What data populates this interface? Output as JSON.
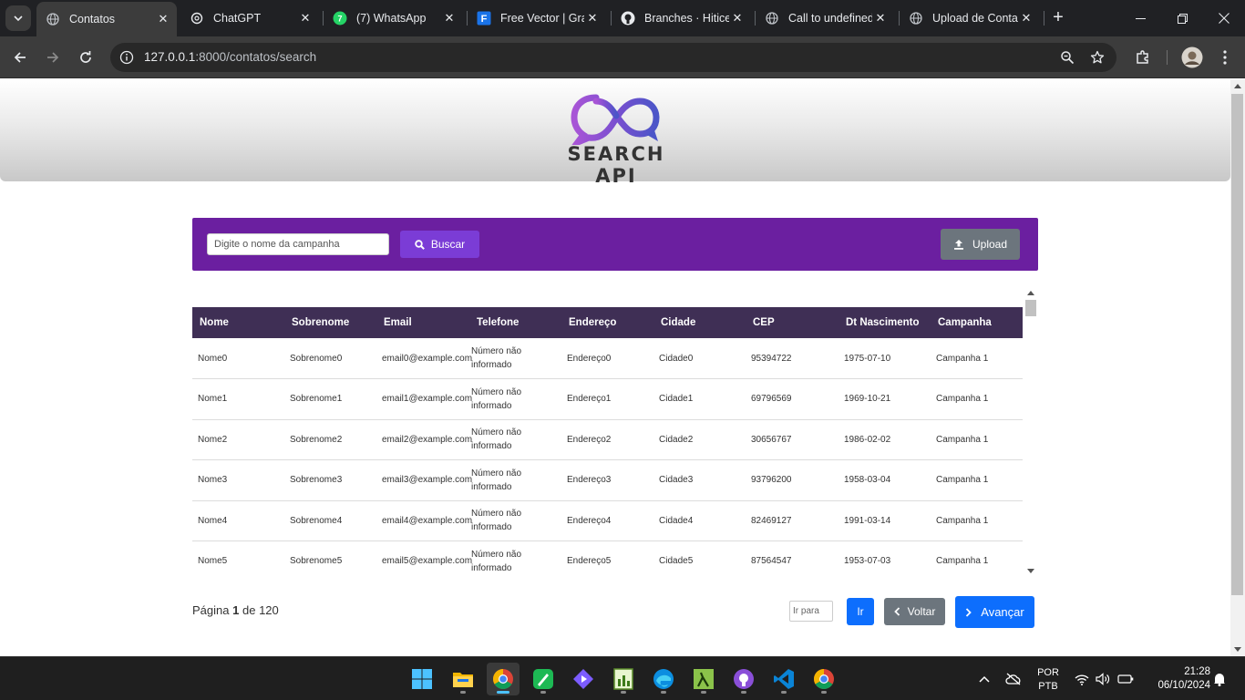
{
  "browser": {
    "tabs": [
      {
        "title": "Contatos",
        "icon": "globe-icon",
        "active": true
      },
      {
        "title": "ChatGPT",
        "icon": "chatgpt-icon",
        "active": false
      },
      {
        "title": "(7) WhatsApp",
        "icon": "whatsapp-icon",
        "active": false
      },
      {
        "title": "Free Vector | Gra",
        "icon": "freepik-icon",
        "active": false
      },
      {
        "title": "Branches · Hitice",
        "icon": "github-icon",
        "active": false
      },
      {
        "title": "Call to undefined",
        "icon": "globe-icon",
        "active": false
      },
      {
        "title": "Upload de Conta",
        "icon": "globe-icon",
        "active": false
      }
    ],
    "url_host": "127.0.0.1",
    "url_rest": ":8000/contatos/search"
  },
  "page": {
    "logo_text": "SEARCH API",
    "search": {
      "placeholder": "Digite o nome da campanha",
      "button_label": "Buscar",
      "upload_label": "Upload"
    },
    "table": {
      "columns": [
        "Nome",
        "Sobrenome",
        "Email",
        "Telefone",
        "Endereço",
        "Cidade",
        "CEP",
        "Dt Nascimento",
        "Campanha"
      ],
      "rows": [
        [
          "Nome0",
          "Sobrenome0",
          "email0@example.com",
          "Número não informado",
          "Endereço0",
          "Cidade0",
          "95394722",
          "1975-07-10",
          "Campanha 1"
        ],
        [
          "Nome1",
          "Sobrenome1",
          "email1@example.com",
          "Número não informado",
          "Endereço1",
          "Cidade1",
          "69796569",
          "1969-10-21",
          "Campanha 1"
        ],
        [
          "Nome2",
          "Sobrenome2",
          "email2@example.com",
          "Número não informado",
          "Endereço2",
          "Cidade2",
          "30656767",
          "1986-02-02",
          "Campanha 1"
        ],
        [
          "Nome3",
          "Sobrenome3",
          "email3@example.com",
          "Número não informado",
          "Endereço3",
          "Cidade3",
          "93796200",
          "1958-03-04",
          "Campanha 1"
        ],
        [
          "Nome4",
          "Sobrenome4",
          "email4@example.com",
          "Número não informado",
          "Endereço4",
          "Cidade4",
          "82469127",
          "1991-03-14",
          "Campanha 1"
        ],
        [
          "Nome5",
          "Sobrenome5",
          "email5@example.com",
          "Número não informado",
          "Endereço5",
          "Cidade5",
          "87564547",
          "1953-07-03",
          "Campanha 1"
        ]
      ]
    },
    "pagination": {
      "prefix": "Página",
      "current": "1",
      "of": "de",
      "total": "120",
      "goto_placeholder": "Ir para",
      "go_label": "Ir",
      "back_label": "Voltar",
      "next_label": "Avançar"
    }
  },
  "taskbar": {
    "lang_top": "POR",
    "lang_bottom": "PTB",
    "time": "21:28",
    "date": "06/10/2024"
  },
  "colors": {
    "search_bar": "#6b1fa0",
    "table_header": "#3f2f55",
    "primary": "#0d6efd",
    "secondary": "#6c757d"
  }
}
